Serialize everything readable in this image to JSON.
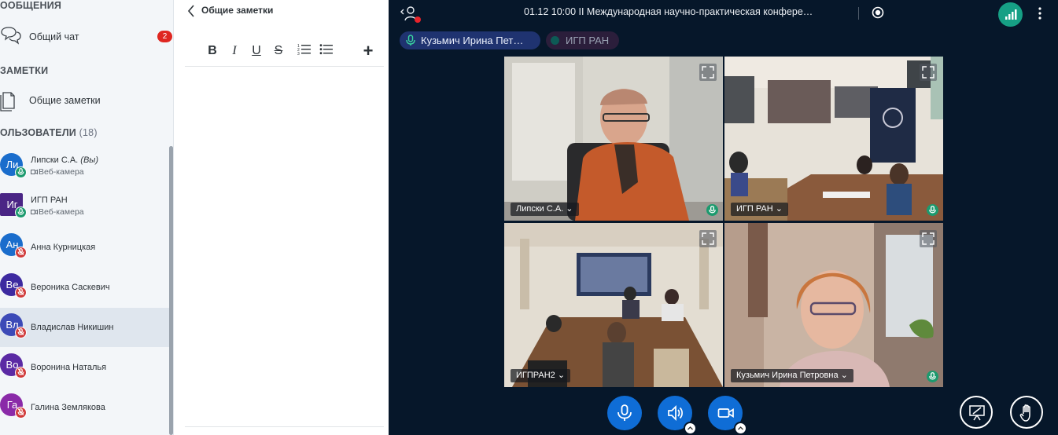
{
  "sidebar": {
    "messages_title": "ООБЩЕНИЯ",
    "public_chat_label": "Общий чат",
    "public_chat_unread": "2",
    "notes_title": "ЗАМЕТКИ",
    "shared_notes_label": "Общие заметки",
    "users_title": "ОЛЬЗОВАТЕЛИ",
    "users_count": "(18)",
    "users": [
      {
        "initials": "Ли",
        "name": "Липски С.А.",
        "you": "(Вы)",
        "sub": "Веб-камера",
        "avatar_color": "#1a6dcc",
        "shape": "circle",
        "voice": "on",
        "active": false
      },
      {
        "initials": "Иг",
        "name": "ИГП РАН",
        "you": "",
        "sub": "Веб-камера",
        "avatar_color": "#4a2585",
        "shape": "square",
        "voice": "on",
        "active": false
      },
      {
        "initials": "Ан",
        "name": "Анна Курницкая",
        "you": "",
        "sub": "",
        "avatar_color": "#1a6dcc",
        "shape": "circle",
        "voice": "off",
        "active": false
      },
      {
        "initials": "Ве",
        "name": "Вероника Саскевич",
        "you": "",
        "sub": "",
        "avatar_color": "#3d2aa0",
        "shape": "circle",
        "voice": "off",
        "active": false
      },
      {
        "initials": "Вл",
        "name": "Владислав Никишин",
        "you": "",
        "sub": "",
        "avatar_color": "#3c4ab7",
        "shape": "circle",
        "voice": "off",
        "active": true
      },
      {
        "initials": "Во",
        "name": "Воронина Наталья",
        "you": "",
        "sub": "",
        "avatar_color": "#5b2aa4",
        "shape": "circle",
        "voice": "off",
        "active": false
      },
      {
        "initials": "Га",
        "name": "Галина Землякова",
        "you": "",
        "sub": "",
        "avatar_color": "#8a2aa8",
        "shape": "circle",
        "voice": "off",
        "active": false
      }
    ]
  },
  "notes": {
    "title": "Общие заметки",
    "toolbar": [
      "B",
      "I",
      "U",
      "S",
      "ordered-list",
      "bullet-list",
      "+"
    ]
  },
  "conference": {
    "title": "01.12 10:00 II Международная научно-практическая конфере…",
    "speaker_pill": "Кузьмич Ирина Пет…",
    "talking_pill": "ИГП РАН",
    "tiles": [
      {
        "label": "Липски С.А.",
        "speaking": false
      },
      {
        "label": "ИГП РАН",
        "speaking": false
      },
      {
        "label": "ИГПРАН2",
        "speaking": false
      },
      {
        "label": "Кузьмич Ирина Петровна",
        "speaking": true
      }
    ]
  },
  "colors": {
    "conference_bg": "#06172a",
    "control_blue": "#0f6dd6",
    "connection_green": "#16a085",
    "unread_red": "#df2721",
    "muted_red": "#d03b3b",
    "voice_green": "#1c9a6e"
  }
}
